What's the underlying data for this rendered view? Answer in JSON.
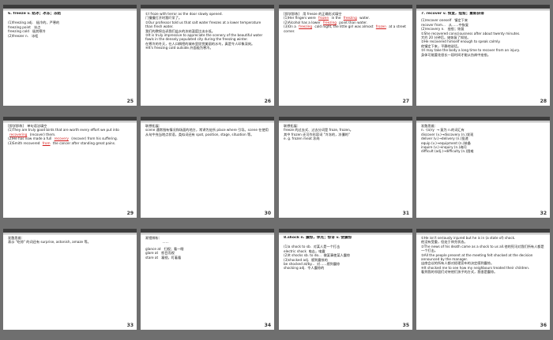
{
  "slides": [
    {
      "num": "25",
      "lines": [
        "6. freeze v. 结冰；冰冻；冻结",
        "",
        "(1)freezing adj.   极冷的，严寒的",
        "freezing point   冰点",
        "freezing cold   极其寒冷",
        "(2)freezer n.   冰柜"
      ]
    },
    {
      "num": "26",
      "lines": [
        "①I froze with terror as the door slowly opened.",
        "门慢慢打开时我吓呆了。",
        "②Our professor told us that salt water freezes at a lower temperature than fresh water.",
        "我们的教授告诉我们盐水的冻结温度比淡水低。",
        "③It is truly impressive to appreciate the scenery of the beautiful water fowls in the densely populated city during the freezing winter.",
        "在寒冷的冬天，在人口稠密的城市里欣赏美丽的水鸟，真是令人印象深刻。",
        "④It's freezing cold outside.外面极为寒冷。"
      ]
    },
    {
      "num": "27",
      "lines": [
        "[即学即练]　用 freeze 的正确形式填空",
        "(1)Her fingers were ____ in the ____ water.",
        "(2)Alcohol has a lower ____ point than water.",
        "(3)On a ____ cold night, the little girl was almost ____ at a street corner."
      ],
      "answers": [
        "frozen",
        "freezing",
        "freezing",
        "freezing",
        "frozen"
      ]
    },
    {
      "num": "28",
      "lines": [
        "7. recover v. 恢复，痊愈；重新获得",
        "(1)recover oneself   镇定下来",
        "recover from...   从……中恢复",
        "(2)recovery n.   痊愈；恢复",
        "①She recovered consciousness after about twenty minutes.",
        "大约 20 分钟后，她恢复了知觉。",
        "②He recovered himself enough to speak calmly.",
        "他镇定下来，平静地说话。",
        "③I may take the body a long time to recover from an injury.",
        "身体可能要花很长一段时间才能从伤病中痊愈。"
      ]
    },
    {
      "num": "29",
      "lines": [
        "[即学即练]　单句语法填空",
        "(1)They are truly good birds that are worth every effort we put into ____ (recover) them.",
        "(2)He has now made a full ____ (recover) from his suffering.",
        "(3)Smith recovered ____ the cancer after standing great pains."
      ],
      "answers": [
        "recovering",
        "recovery",
        "from"
      ]
    },
    {
      "num": "30",
      "lines": [
        "联想拓展：",
        "scene 通常指有情况和场面的地方，常译为处所 place where 引导。scene 在使用从句中充当地点状语，类似词还有 spot, position, stage, situation 等。"
      ]
    },
    {
      "num": "31",
      "lines": [
        "联想拓展：",
        "freeze 的过去式、过去分词是 froze, frozen。",
        "其中 frozen 还可作形容词 \"冷冻的，冻僵的\"",
        "e. g. frozen meat 冻肉"
      ]
    },
    {
      "num": "32",
      "lines": [
        "发散思维：",
        "n. -(a)ry  → 复为 n.的词汇有",
        "discover (v.)→discovery (n.)发现",
        "deliver (v.)→delivery (n.)投递",
        "equip (v.)→equipment (n.)装备",
        "inquire (v.)→inquiry (n.)询问",
        "difficult (adj.)→difficulty (n.)困难"
      ]
    },
    {
      "num": "33",
      "lines": [
        "发散思维：",
        "表示 \"吃惊\" 的词还有 surprise, astonish, amaze 等。"
      ]
    },
    {
      "num": "34",
      "lines": [
        "易错辨析：",
        "                ……",
        "",
        "glance at   扫视；看一眼",
        "glare at   怒目而视",
        "stare at   凝视，盯着看"
      ]
    },
    {
      "num": "35",
      "lines": [
        "8.shock n. 震惊，休克；惊讶 v. 使震惊",
        "",
        "(1)a shock to sb.  对某人是一个打击",
        "electric shock  电击，电震",
        "(2)It shocks sb. to do...  做某事使某人震惊",
        "(3)shocked adj.  感到震惊的",
        "be shocked at/by...  对……感到震惊",
        "shocking adj.  令人震惊的"
      ]
    },
    {
      "num": "36",
      "lines": [
        "①He isn't seriously injured but he is in (a state of) shock.",
        "他没有受重，但处于休克状态。",
        "②The news of his death came as a shock to us all.他的死讯对我们所有人都是一个打击。",
        "③All the people present at the meeting felt shocked at the decision announced by the manager.",
        "出席会议的所有人都对经理宣布的决定感到震惊。",
        "④It shocked me to see how my neighbours treated their children.",
        "看到我的邻居们对待他们孩子的方式，我很是震惊。"
      ]
    }
  ]
}
